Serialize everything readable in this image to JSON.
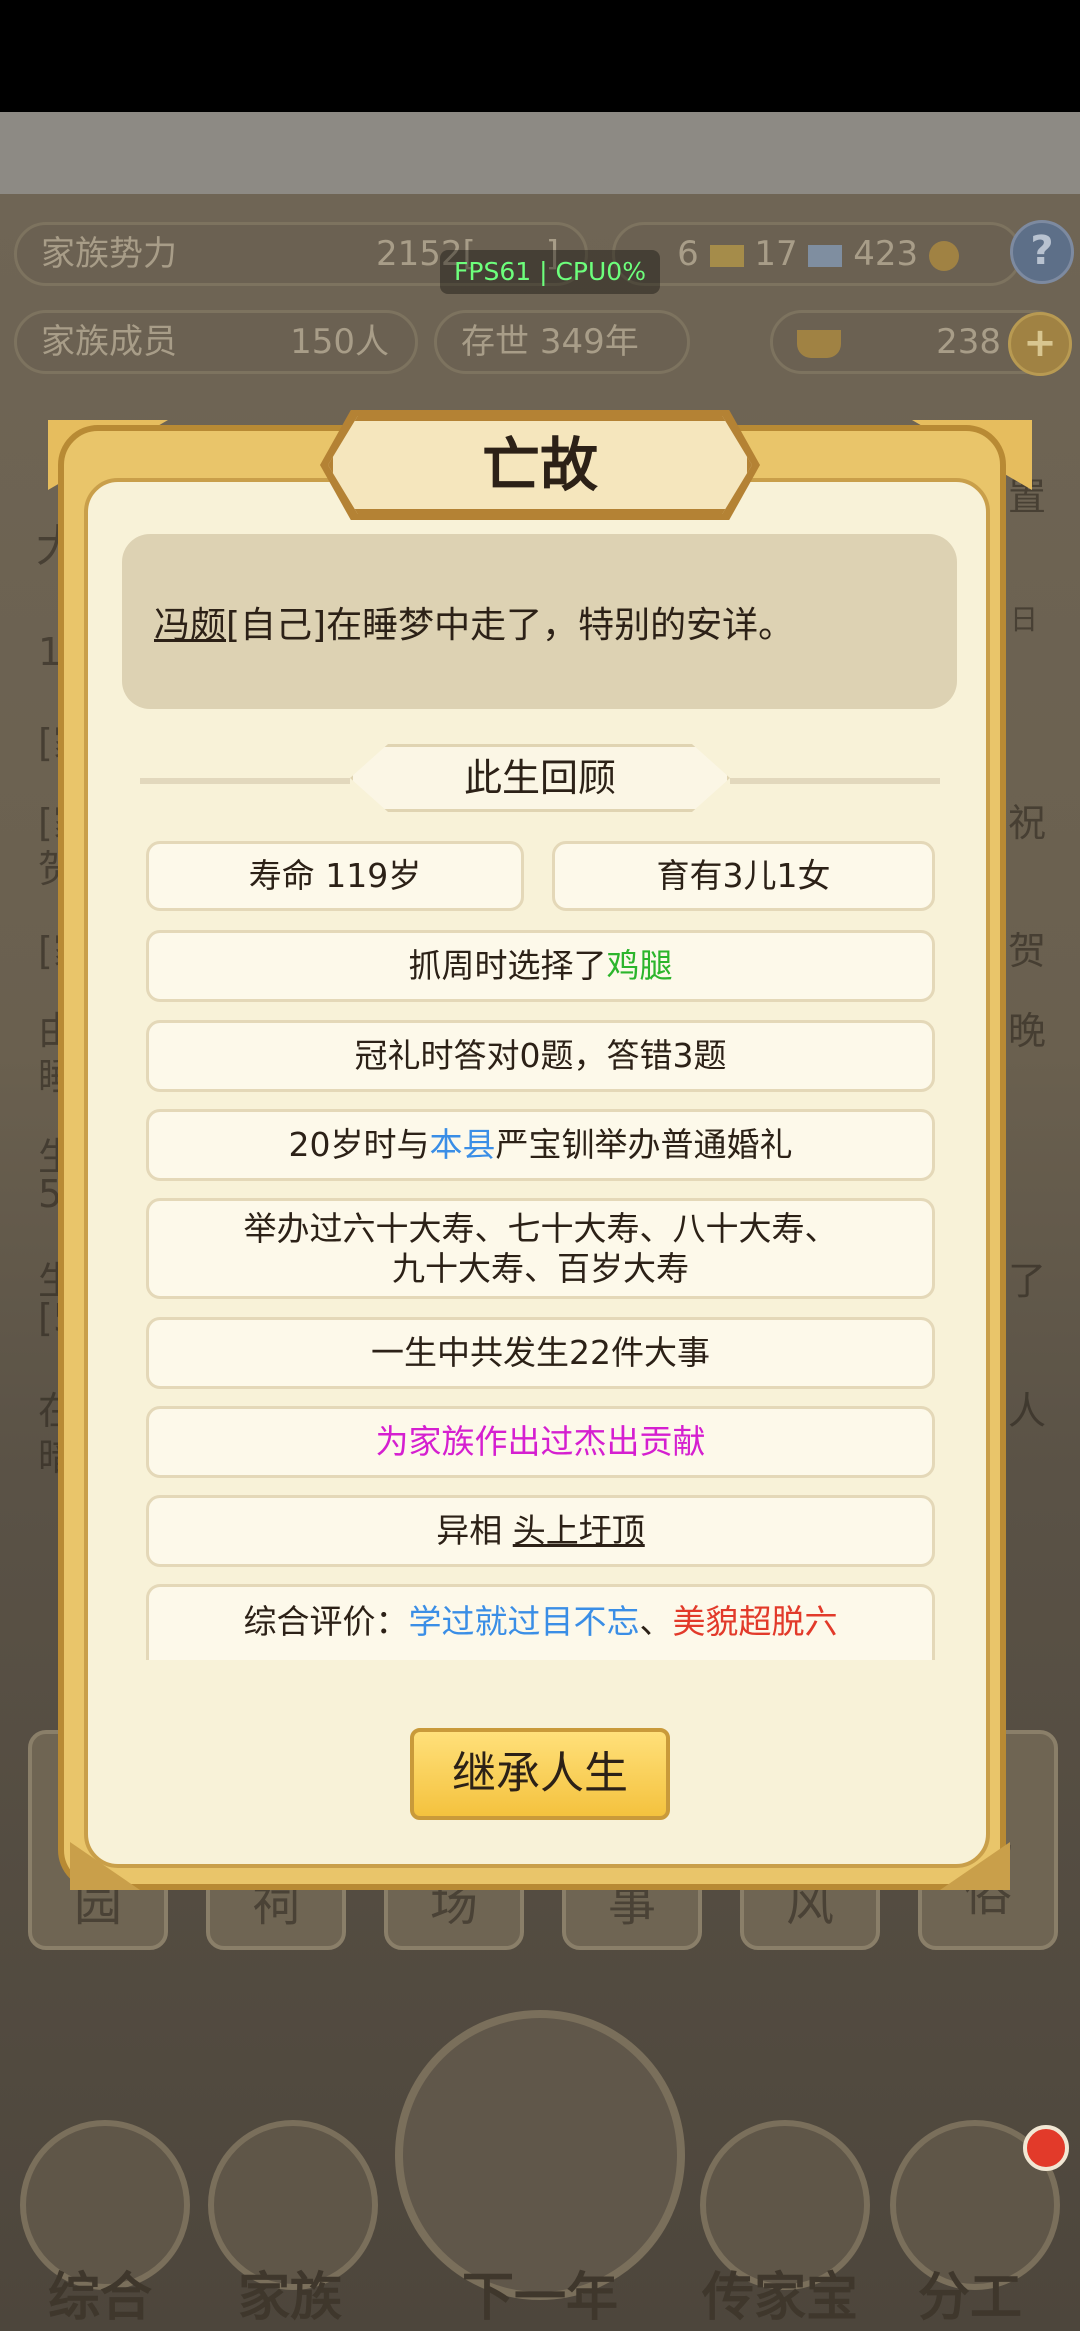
{
  "hud": {
    "fps": "FPS61 | CPU0%",
    "family_power_label": "家族势力",
    "family_power_value": "2152[",
    "family_power_tail": "]",
    "members_label": "家族成员",
    "members_value": "150人",
    "survival_label": "存世",
    "survival_value": "349年",
    "currency_a": "6",
    "currency_b": "17",
    "currency_c": "423",
    "gold_value": "238",
    "help_icon": "?"
  },
  "background": {
    "left_fragments": [
      "大",
      "1",
      "[家",
      "[家",
      "贺",
      "[家",
      "由",
      "睡",
      "生",
      "51",
      "生",
      "[5",
      "在",
      "暗"
    ],
    "right_fragments": [
      "置",
      "日",
      "祝",
      "贺",
      "晚",
      "了",
      "人"
    ],
    "menu_chars": [
      "园",
      "祠",
      "场",
      "事",
      "风",
      "风俗"
    ],
    "nav": [
      "综合",
      "家族",
      "下一年",
      "传家宝",
      "分工"
    ]
  },
  "dialog": {
    "title": "亡故",
    "death_name": "冯颇",
    "death_rest": "[自己]在睡梦中走了，特别的安详。",
    "section_title": "此生回顾",
    "lifespan": "寿命 119岁",
    "children": "育有3儿1女",
    "grab_prefix": "抓周时选择了",
    "grab_item": "鸡腿",
    "capping": "冠礼时答对0题，答错3题",
    "marriage_prefix": "20岁时与",
    "marriage_place": "本县",
    "marriage_suffix": "严宝钏举办普通婚礼",
    "birthdays_line1": "举办过六十大寿、七十大寿、八十大寿、",
    "birthdays_line2": "九十大寿、百岁大寿",
    "events": "一生中共发生22件大事",
    "contribution": "为家族作出过杰出贡献",
    "trait_prefix": "异相 ",
    "trait_value": "头上圩顶",
    "eval_prefix": "综合评价：",
    "eval_a": "学过就过目不忘",
    "eval_sep": "、",
    "eval_b": "美貌超脱六",
    "inherit_button": "继承人生"
  },
  "colors": {
    "green": "#2cb52c",
    "blue": "#3a8ee6",
    "magenta": "#d51fd0",
    "red": "#e23a2a"
  }
}
